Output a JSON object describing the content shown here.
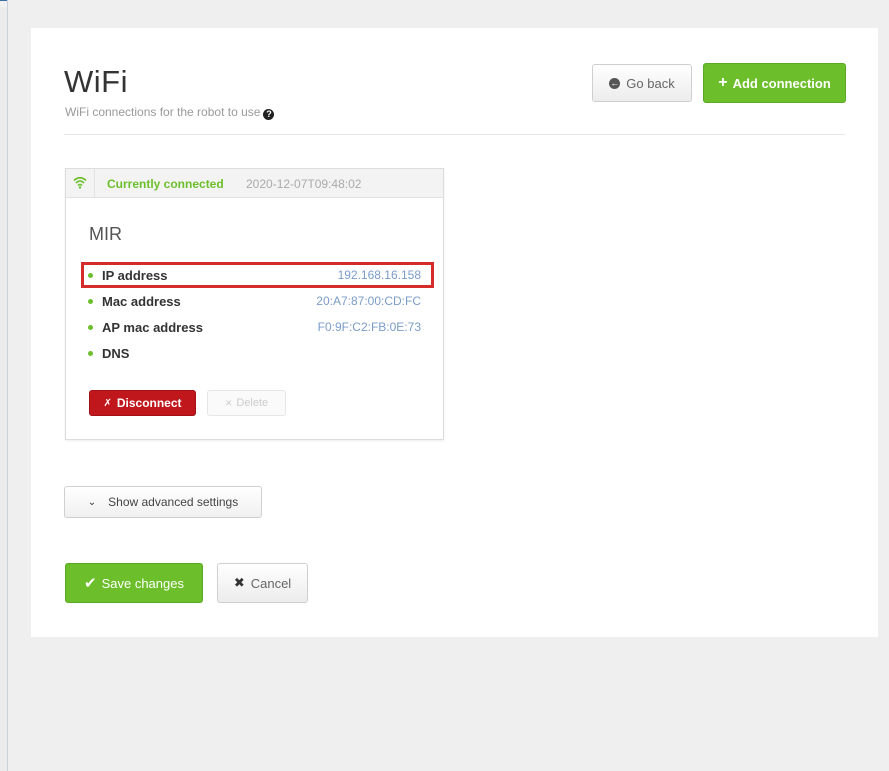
{
  "header": {
    "title": "WiFi",
    "subtitle": "WiFi connections for the robot to use",
    "help_icon": "question-circle-icon",
    "go_back_label": "Go back",
    "add_connection_label": "Add connection"
  },
  "connection_card": {
    "status": "Currently connected",
    "timestamp": "2020-12-07T09:48:02",
    "ssid": "MIR",
    "details": [
      {
        "label": "IP address",
        "value": "192.168.16.158"
      },
      {
        "label": "Mac address",
        "value": "20:A7:87:00:CD:FC"
      },
      {
        "label": "AP mac address",
        "value": "F0:9F:C2:FB:0E:73"
      },
      {
        "label": "DNS",
        "value": ""
      }
    ],
    "disconnect_label": "Disconnect",
    "delete_label": "Delete"
  },
  "advanced": {
    "toggle_label": "Show advanced settings"
  },
  "footer": {
    "save_label": "Save changes",
    "cancel_label": "Cancel"
  },
  "colors": {
    "accent_green": "#6cbf2b",
    "danger_red": "#c0171c",
    "highlight_red": "#d62b2b",
    "value_blue": "#7a9cc8"
  }
}
